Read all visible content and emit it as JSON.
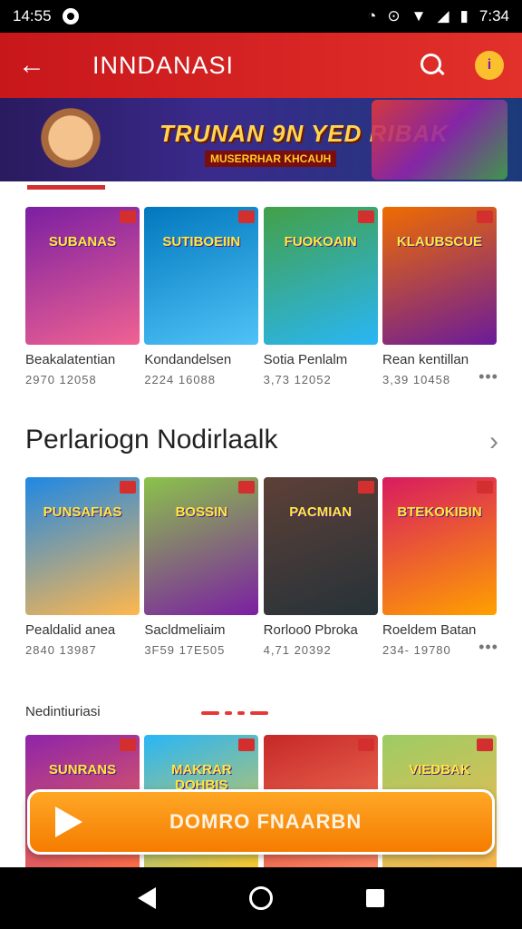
{
  "status_bar": {
    "time": "14:55",
    "clock": "7:34"
  },
  "app_bar": {
    "title": "INNDANASI"
  },
  "banner": {
    "headline": "TRUNAN 9N YED RIBAK",
    "subline": "MUSERRHAR KHCAUH"
  },
  "row1": [
    {
      "art_title": "SUBANAS",
      "name": "Beakalatentian",
      "meta": "2970 12058",
      "colors": [
        "#7b1fa2",
        "#f06292"
      ]
    },
    {
      "art_title": "SUTIBOEIIN",
      "name": "Kondandelsen",
      "meta": "2224 16088",
      "colors": [
        "#0277bd",
        "#4fc3f7"
      ]
    },
    {
      "art_title": "FUOKOAIN",
      "name": "Sotia Penlalm",
      "meta": "3,73 12052",
      "colors": [
        "#43a047",
        "#29b6f6"
      ]
    },
    {
      "art_title": "KLAUBSCUE",
      "name": "Rean kentillan",
      "meta": "3,39 10458",
      "colors": [
        "#ef6c00",
        "#6a1b9a"
      ]
    }
  ],
  "section": {
    "title": "Perlariogn Nodirlaalk",
    "sub_label": "Nedintiuriasi"
  },
  "row2": [
    {
      "art_title": "PUNSAFIAS",
      "name": "Pealdalid anea",
      "meta": "2840 13987",
      "colors": [
        "#1e88e5",
        "#ffb74d"
      ]
    },
    {
      "art_title": "BOSSIN",
      "name": "Sacldmeliaim",
      "meta": "3F59 17E505",
      "colors": [
        "#8bc34a",
        "#7b1fa2"
      ]
    },
    {
      "art_title": "PACMIAN",
      "name": "Rorloo0 Pbroka",
      "meta": "4,71 20392",
      "colors": [
        "#5d4037",
        "#263238"
      ]
    },
    {
      "art_title": "BTEKOKIBIN",
      "name": "Roeldem Batan",
      "meta": "234- 19780",
      "colors": [
        "#d81b60",
        "#ffa000"
      ]
    }
  ],
  "row3": [
    {
      "art_title": "SUNRANS",
      "colors": [
        "#8e24aa",
        "#ff7043"
      ]
    },
    {
      "art_title": "MAKRAR DOHBIS",
      "colors": [
        "#29b6f6",
        "#ffca28"
      ]
    },
    {
      "art_title": "",
      "colors": [
        "#c62828",
        "#ff8a65"
      ]
    },
    {
      "art_title": "VIEDBAK",
      "colors": [
        "#9ccc65",
        "#ffb74d"
      ]
    }
  ],
  "install": {
    "label": "DOMRO FNAARBN"
  }
}
